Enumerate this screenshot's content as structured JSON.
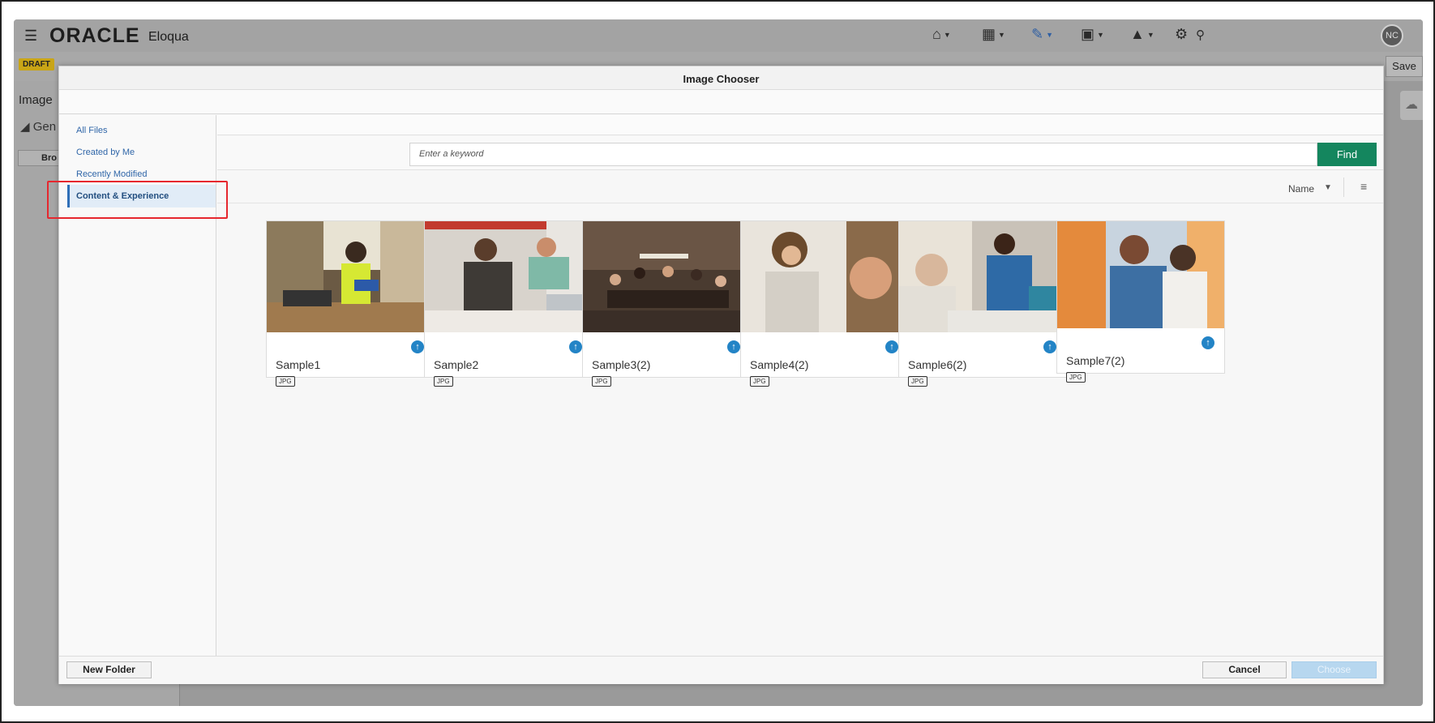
{
  "app": {
    "brand": "ORACLE",
    "brand_sub": "Eloqua",
    "avatar": "NC",
    "draft_badge": "DRAFT",
    "save_label": "Save",
    "left_panel_title": "Image",
    "left_panel_group": "Gen",
    "left_panel_button": "Bro"
  },
  "dialog": {
    "title": "Image Chooser",
    "nav": [
      {
        "label": "All Files"
      },
      {
        "label": "Created by Me"
      },
      {
        "label": "Recently Modified"
      },
      {
        "label": "Content & Experience",
        "active": true
      }
    ],
    "search_placeholder": "Enter a keyword",
    "find_label": "Find",
    "sort_label": "Name",
    "cards": [
      {
        "name": "Sample1",
        "type": "JPG"
      },
      {
        "name": "Sample2",
        "type": "JPG"
      },
      {
        "name": "Sample3(2)",
        "type": "JPG"
      },
      {
        "name": "Sample4(2)",
        "type": "JPG"
      },
      {
        "name": "Sample6(2)",
        "type": "JPG"
      },
      {
        "name": "Sample7(2)",
        "type": "JPG"
      }
    ],
    "new_folder_label": "New Folder",
    "cancel_label": "Cancel",
    "choose_label": "Choose"
  },
  "colors": {
    "accent_blue": "#2f6fb7",
    "find_green": "#14865e",
    "highlight_red": "#e6272e",
    "draft_yellow": "#c9a516"
  },
  "icons": [
    "hamburger-icon",
    "home-icon",
    "dashboard-icon",
    "edit-icon",
    "contacts-icon",
    "analytics-icon",
    "settings-icon",
    "search-icon",
    "upload-icon",
    "list-view-icon",
    "cloud-icon"
  ]
}
